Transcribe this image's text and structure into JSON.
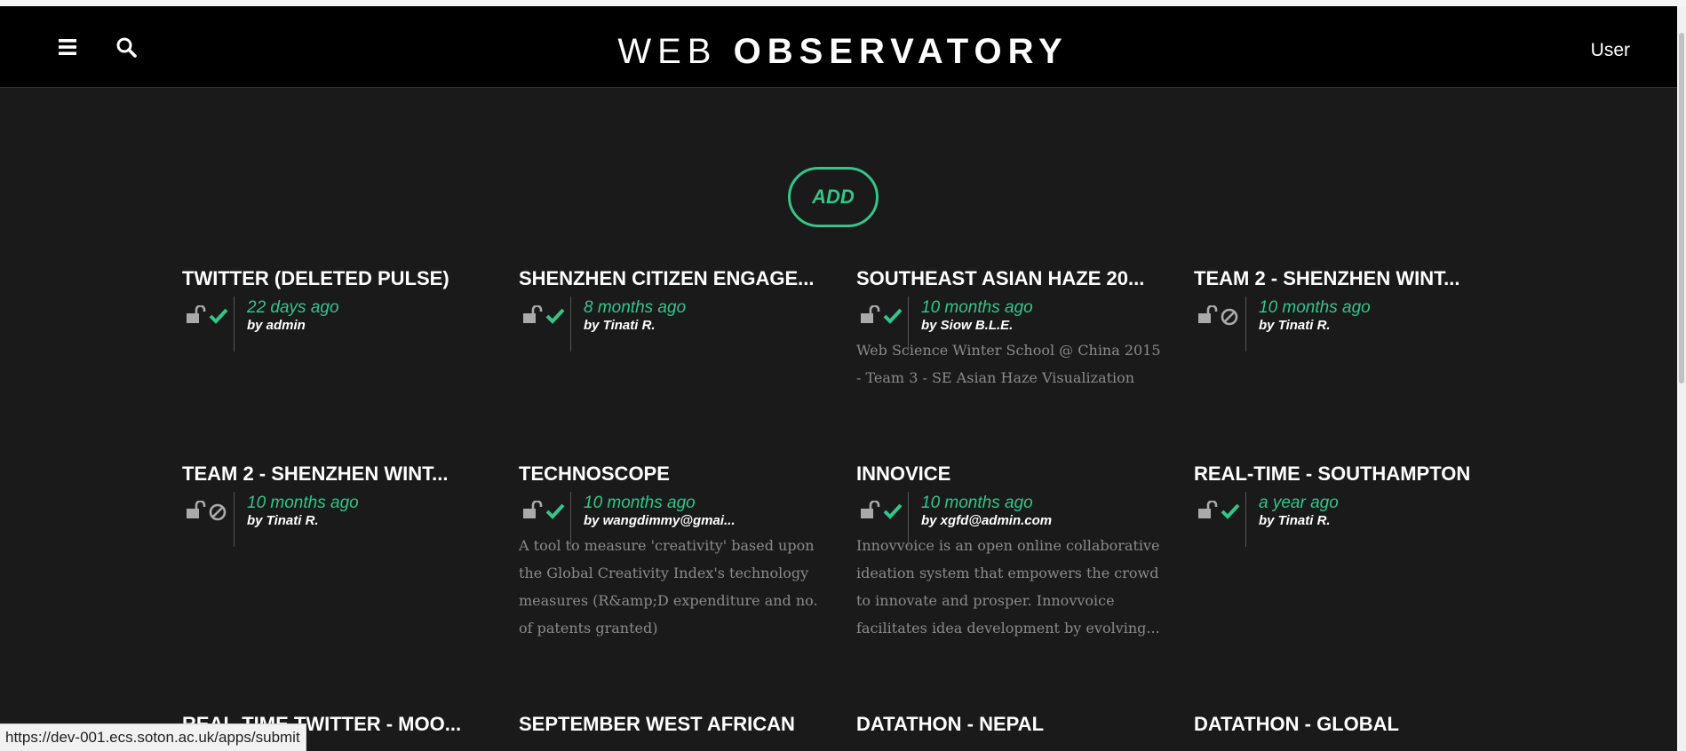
{
  "header": {
    "title_light": "WEB",
    "title_bold": "OBSERVATORY",
    "user_label": "User"
  },
  "add_label": "ADD",
  "cards": [
    {
      "title": "TWITTER (DELETED PULSE)",
      "date": "22 days ago",
      "author": "by admin",
      "status": "check",
      "description": ""
    },
    {
      "title": "SHENZHEN CITIZEN ENGAGE...",
      "date": "8 months ago",
      "author": "by Tinati R.",
      "status": "check",
      "description": ""
    },
    {
      "title": "SOUTHEAST ASIAN HAZE 20...",
      "date": "10 months ago",
      "author": "by Siow B.L.E.",
      "status": "check",
      "description": "Web Science Winter School @ China 2015 - Team 3 - SE Asian Haze Visualization"
    },
    {
      "title": "TEAM 2 - SHENZHEN WINT...",
      "date": "10 months ago",
      "author": "by Tinati R.",
      "status": "blocked",
      "description": ""
    },
    {
      "title": "TEAM 2 - SHENZHEN WINT...",
      "date": "10 months ago",
      "author": "by Tinati R.",
      "status": "blocked",
      "description": ""
    },
    {
      "title": "TECHNOSCOPE",
      "date": "10 months ago",
      "author": "by wangdimmy@gmai...",
      "status": "check",
      "description": "A tool to measure 'creativity' based upon the Global Creativity Index's technology measures (R&amp;D expenditure and no. of patents granted)"
    },
    {
      "title": "INNOVICE",
      "date": "10 months ago",
      "author": "by xgfd@admin.com",
      "status": "check",
      "description": "Innovvoice is an open online collaborative ideation system that empowers the crowd to innovate and prosper. Innovvoice facilitates idea development by evolving..."
    },
    {
      "title": "REAL-TIME - SOUTHAMPTON",
      "date": "a year ago",
      "author": "by Tinati R.",
      "status": "check",
      "description": ""
    },
    {
      "title": "REAL-TIME TWITTER - MOO...",
      "date": "",
      "author": "",
      "status": "",
      "description": ""
    },
    {
      "title": "SEPTEMBER WEST AFRICAN",
      "date": "",
      "author": "",
      "status": "",
      "description": ""
    },
    {
      "title": "DATATHON - NEPAL",
      "date": "",
      "author": "",
      "status": "",
      "description": ""
    },
    {
      "title": "DATATHON - GLOBAL",
      "date": "",
      "author": "",
      "status": "",
      "description": ""
    }
  ],
  "status_bar_url": "https://dev-001.ecs.soton.ac.uk/apps/submit",
  "colors": {
    "accent": "#34c48c",
    "background": "#1a1a1a",
    "header": "#000000"
  }
}
